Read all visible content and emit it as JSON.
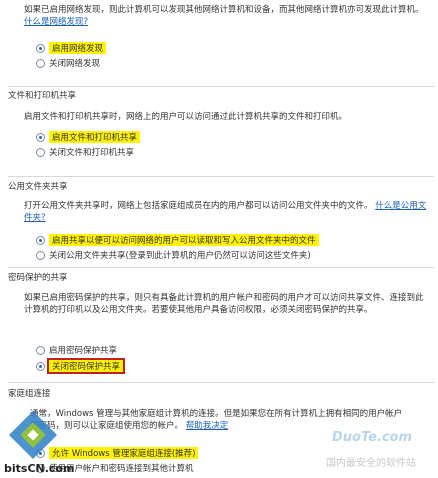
{
  "network_discovery": {
    "description": "如果已启用网络发现，则此计算机可以发现其他网络计算机和设备，而其他网络计算机亦可发现此计算机。",
    "link": "什么是网络发现?",
    "options": [
      {
        "label": "启用网络发现",
        "selected": true
      },
      {
        "label": "关闭网络发现",
        "selected": false
      }
    ]
  },
  "file_printer_sharing": {
    "title": "文件和打印机共享",
    "description": "启用文件和打印机共享时，网络上的用户可以访问通过此计算机共享的文件和打印机。",
    "options": [
      {
        "label": "启用文件和打印机共享",
        "selected": true
      },
      {
        "label": "关闭文件和打印机共享",
        "selected": false
      }
    ]
  },
  "public_folder_sharing": {
    "title": "公用文件夹共享",
    "description": "打开公用文件夹共享时，网络上包括家庭组成员在内的用户都可以访问公用文件夹中的文件。",
    "link_inline": "什么",
    "link": "是公用文件夹?",
    "options": [
      {
        "label": "启用共享以便可以访问网络的用户可以读取和写入公用文件夹中的文件",
        "selected": true
      },
      {
        "label": "关闭公用文件夹共享(登录到此计算机的用户仍然可以访问这些文件夹)",
        "selected": false
      }
    ]
  },
  "password_protected_sharing": {
    "title": "密码保护的共享",
    "description": "如果已启用密码保护的共享，则只有具备此计算机的用户帐户和密码的用户才可以访问共享文件、连接到此计算机的打印机以及公用文件夹。若要使其他用户具备访问权限，必须关闭密码保护的共享。",
    "options": [
      {
        "label": "启用密码保护共享",
        "selected": false
      },
      {
        "label": "关闭密码保护共享",
        "selected": true
      }
    ]
  },
  "homegroup": {
    "title": "家庭组连接",
    "description_1": "通常，Windows 管理与其他家庭组计算机的连接。但是如果您在所有计算机上拥有相同的用户帐户",
    "description_2": "和密码，则可以让家庭组使用您的帐户。",
    "link": "帮助我决定",
    "options": [
      {
        "label": "允许 Windows 管理家庭组连接(推荐)",
        "selected": true
      },
      {
        "label": "使用用户帐户和密码连接到其他计算机",
        "selected": false
      }
    ]
  },
  "watermarks": {
    "left_text": "bitsCN.com",
    "right_text": "DuoTe.com",
    "right_sub": "国内最安全的软件站"
  },
  "colors": {
    "highlight": "#fff200",
    "box_border": "#c0201e",
    "link": "#1a5fb4"
  }
}
